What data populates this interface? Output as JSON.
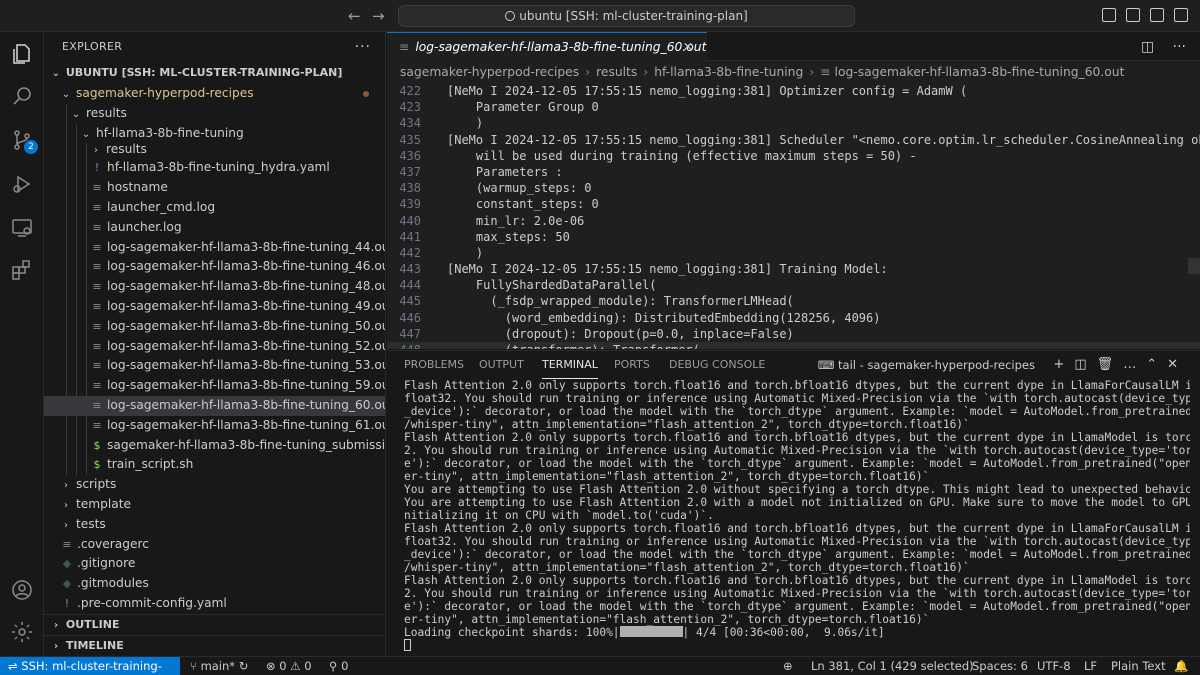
{
  "titlebar": {
    "search": "ubuntu [SSH: ml-cluster-training-plan]"
  },
  "activity": {
    "source_control_badge": "2"
  },
  "explorer": {
    "title": "EXPLORER",
    "root": "UBUNTU [SSH: ML-CLUSTER-TRAINING-PLAN]",
    "items": [
      {
        "label": "sagemaker-hyperpod-recipes",
        "kind": "folder-open",
        "depth": 1,
        "modified": true,
        "accent": "#e2c08d"
      },
      {
        "label": "results",
        "kind": "folder-open",
        "depth": 2
      },
      {
        "label": "hf-llama3-8b-fine-tuning",
        "kind": "folder-open",
        "depth": 3
      },
      {
        "label": "results",
        "kind": "folder",
        "depth": 4
      },
      {
        "label": "hf-llama3-8b-fine-tuning_hydra.yaml",
        "kind": "yaml",
        "depth": 4
      },
      {
        "label": "hostname",
        "kind": "file",
        "depth": 4
      },
      {
        "label": "launcher_cmd.log",
        "kind": "file",
        "depth": 4
      },
      {
        "label": "launcher.log",
        "kind": "file",
        "depth": 4
      },
      {
        "label": "log-sagemaker-hf-llama3-8b-fine-tuning_44.out",
        "kind": "file",
        "depth": 4
      },
      {
        "label": "log-sagemaker-hf-llama3-8b-fine-tuning_46.out",
        "kind": "file",
        "depth": 4
      },
      {
        "label": "log-sagemaker-hf-llama3-8b-fine-tuning_48.out",
        "kind": "file",
        "depth": 4
      },
      {
        "label": "log-sagemaker-hf-llama3-8b-fine-tuning_49.out",
        "kind": "file",
        "depth": 4
      },
      {
        "label": "log-sagemaker-hf-llama3-8b-fine-tuning_50.out",
        "kind": "file",
        "depth": 4
      },
      {
        "label": "log-sagemaker-hf-llama3-8b-fine-tuning_52.out",
        "kind": "file",
        "depth": 4
      },
      {
        "label": "log-sagemaker-hf-llama3-8b-fine-tuning_53.out",
        "kind": "file",
        "depth": 4
      },
      {
        "label": "log-sagemaker-hf-llama3-8b-fine-tuning_59.out",
        "kind": "file",
        "depth": 4
      },
      {
        "label": "log-sagemaker-hf-llama3-8b-fine-tuning_60.out",
        "kind": "file",
        "depth": 4,
        "selected": true
      },
      {
        "label": "log-sagemaker-hf-llama3-8b-fine-tuning_61.out",
        "kind": "file",
        "depth": 4
      },
      {
        "label": "sagemaker-hf-llama3-8b-fine-tuning_submission.sh",
        "kind": "shell",
        "depth": 4
      },
      {
        "label": "train_script.sh",
        "kind": "shell",
        "depth": 4
      },
      {
        "label": "scripts",
        "kind": "folder",
        "depth": 1
      },
      {
        "label": "template",
        "kind": "folder",
        "depth": 1
      },
      {
        "label": "tests",
        "kind": "folder",
        "depth": 1
      },
      {
        "label": ".coveragerc",
        "kind": "config",
        "depth": 1
      },
      {
        "label": ".gitignore",
        "kind": "git",
        "depth": 1
      },
      {
        "label": ".gitmodules",
        "kind": "git",
        "depth": 1
      },
      {
        "label": ".pre-commit-config.yaml",
        "kind": "yaml",
        "depth": 1
      }
    ],
    "outline": "OUTLINE",
    "timeline": "TIMELINE"
  },
  "editor": {
    "tab": "log-sagemaker-hf-llama3-8b-fine-tuning_60.out",
    "breadcrumb": [
      "sagemaker-hyperpod-recipes",
      "results",
      "hf-llama3-8b-fine-tuning",
      "log-sagemaker-hf-llama3-8b-fine-tuning_60.out"
    ],
    "lines": [
      {
        "n": "422",
        "t": "[NeMo I 2024-12-05 17:55:15 nemo_logging:381] Optimizer config = AdamW ("
      },
      {
        "n": "423",
        "t": "    Parameter Group 0"
      },
      {
        "n": "434",
        "t": "    )"
      },
      {
        "n": "435",
        "t": "[NeMo I 2024-12-05 17:55:15 nemo_logging:381] Scheduler \"<nemo.core.optim.lr_scheduler.CosineAnnealing object at 0x7"
      },
      {
        "n": "436",
        "t": "    will be used during training (effective maximum steps = 50) -"
      },
      {
        "n": "437",
        "t": "    Parameters :"
      },
      {
        "n": "438",
        "t": "    (warmup_steps: 0"
      },
      {
        "n": "439",
        "t": "    constant_steps: 0"
      },
      {
        "n": "440",
        "t": "    min_lr: 2.0e-06"
      },
      {
        "n": "441",
        "t": "    max_steps: 50"
      },
      {
        "n": "442",
        "t": "    )"
      },
      {
        "n": "443",
        "t": "[NeMo I 2024-12-05 17:55:15 nemo_logging:381] Training Model:"
      },
      {
        "n": "444",
        "t": "    FullyShardedDataParallel("
      },
      {
        "n": "445",
        "t": "      (_fsdp_wrapped_module): TransformerLMHead("
      },
      {
        "n": "446",
        "t": "        (word_embedding): DistributedEmbedding(128256, 4096)"
      },
      {
        "n": "447",
        "t": "        (dropout): Dropout(p=0.0, inplace=False)"
      },
      {
        "n": "448",
        "t": "        (transformer): Transformer("
      }
    ]
  },
  "panel": {
    "tabs": [
      "PROBLEMS",
      "OUTPUT",
      "TERMINAL",
      "PORTS",
      "DEBUG CONSOLE"
    ],
    "terminal_name": "tail - sagemaker-hyperpod-recipes",
    "lines": [
      "Flash Attention 2.0 only supports torch.float16 and torch.bfloat16 dtypes, but the current dype in LlamaForCausalLM is torch.",
      "float32. You should run training or inference using Automatic Mixed-Precision via the `with torch.autocast(device_type='torch",
      "_device'):` decorator, or load the model with the `torch_dtype` argument. Example: `model = AutoModel.from_pretrained(\"openai",
      "/whisper-tiny\", attn_implementation=\"flash_attention_2\", torch_dtype=torch.float16)`",
      "Flash Attention 2.0 only supports torch.float16 and torch.bfloat16 dtypes, but the current dype in LlamaModel is torch.float3",
      "2. You should run training or inference using Automatic Mixed-Precision via the `with torch.autocast(device_type='torch_devic",
      "e'):` decorator, or load the model with the `torch_dtype` argument. Example: `model = AutoModel.from_pretrained(\"openai/whisp",
      "er-tiny\", attn_implementation=\"flash_attention_2\", torch_dtype=torch.float16)`",
      "You are attempting to use Flash Attention 2.0 without specifying a torch dtype. This might lead to unexpected behaviour",
      "You are attempting to use Flash Attention 2.0 with a model not initialized on GPU. Make sure to move the model to GPU after i",
      "nitializing it on CPU with `model.to('cuda')`.",
      "Flash Attention 2.0 only supports torch.float16 and torch.bfloat16 dtypes, but the current dype in LlamaForCausalLM is torch.",
      "float32. You should run training or inference using Automatic Mixed-Precision via the `with torch.autocast(device_type='torch",
      "_device'):` decorator, or load the model with the `torch_dtype` argument. Example: `model = AutoModel.from_pretrained(\"openai",
      "/whisper-tiny\", attn_implementation=\"flash_attention_2\", torch_dtype=torch.float16)`",
      "Flash Attention 2.0 only supports torch.float16 and torch.bfloat16 dtypes, but the current dype in LlamaModel is torch.float3",
      "2. You should run training or inference using Automatic Mixed-Precision via the `with torch.autocast(device_type='torch_devic",
      "e'):` decorator, or load the model with the `torch_dtype` argument. Example: `model = AutoModel.from_pretrained(\"openai/whisp",
      "er-tiny\", attn_implementation=\"flash_attention_2\", torch_dtype=torch.float16)`"
    ],
    "progress_prefix": "Loading checkpoint shards: 100%|",
    "progress_suffix": "| 4/4 [00:36<00:00,  9.06s/it]",
    "progress_fraction": 1.0
  },
  "status": {
    "remote": "SSH: ml-cluster-training-plan",
    "branch": "main*",
    "errors": "0",
    "warnings": "0",
    "ports": "0",
    "position": "Ln 381, Col 1 (429 selected)",
    "spaces": "Spaces: 6",
    "encoding": "UTF-8",
    "eol": "LF",
    "language": "Plain Text"
  },
  "colors": {
    "accent": "#0078d4",
    "yaml": "#a074c4",
    "shell": "#89e051",
    "git": "#41535b"
  }
}
